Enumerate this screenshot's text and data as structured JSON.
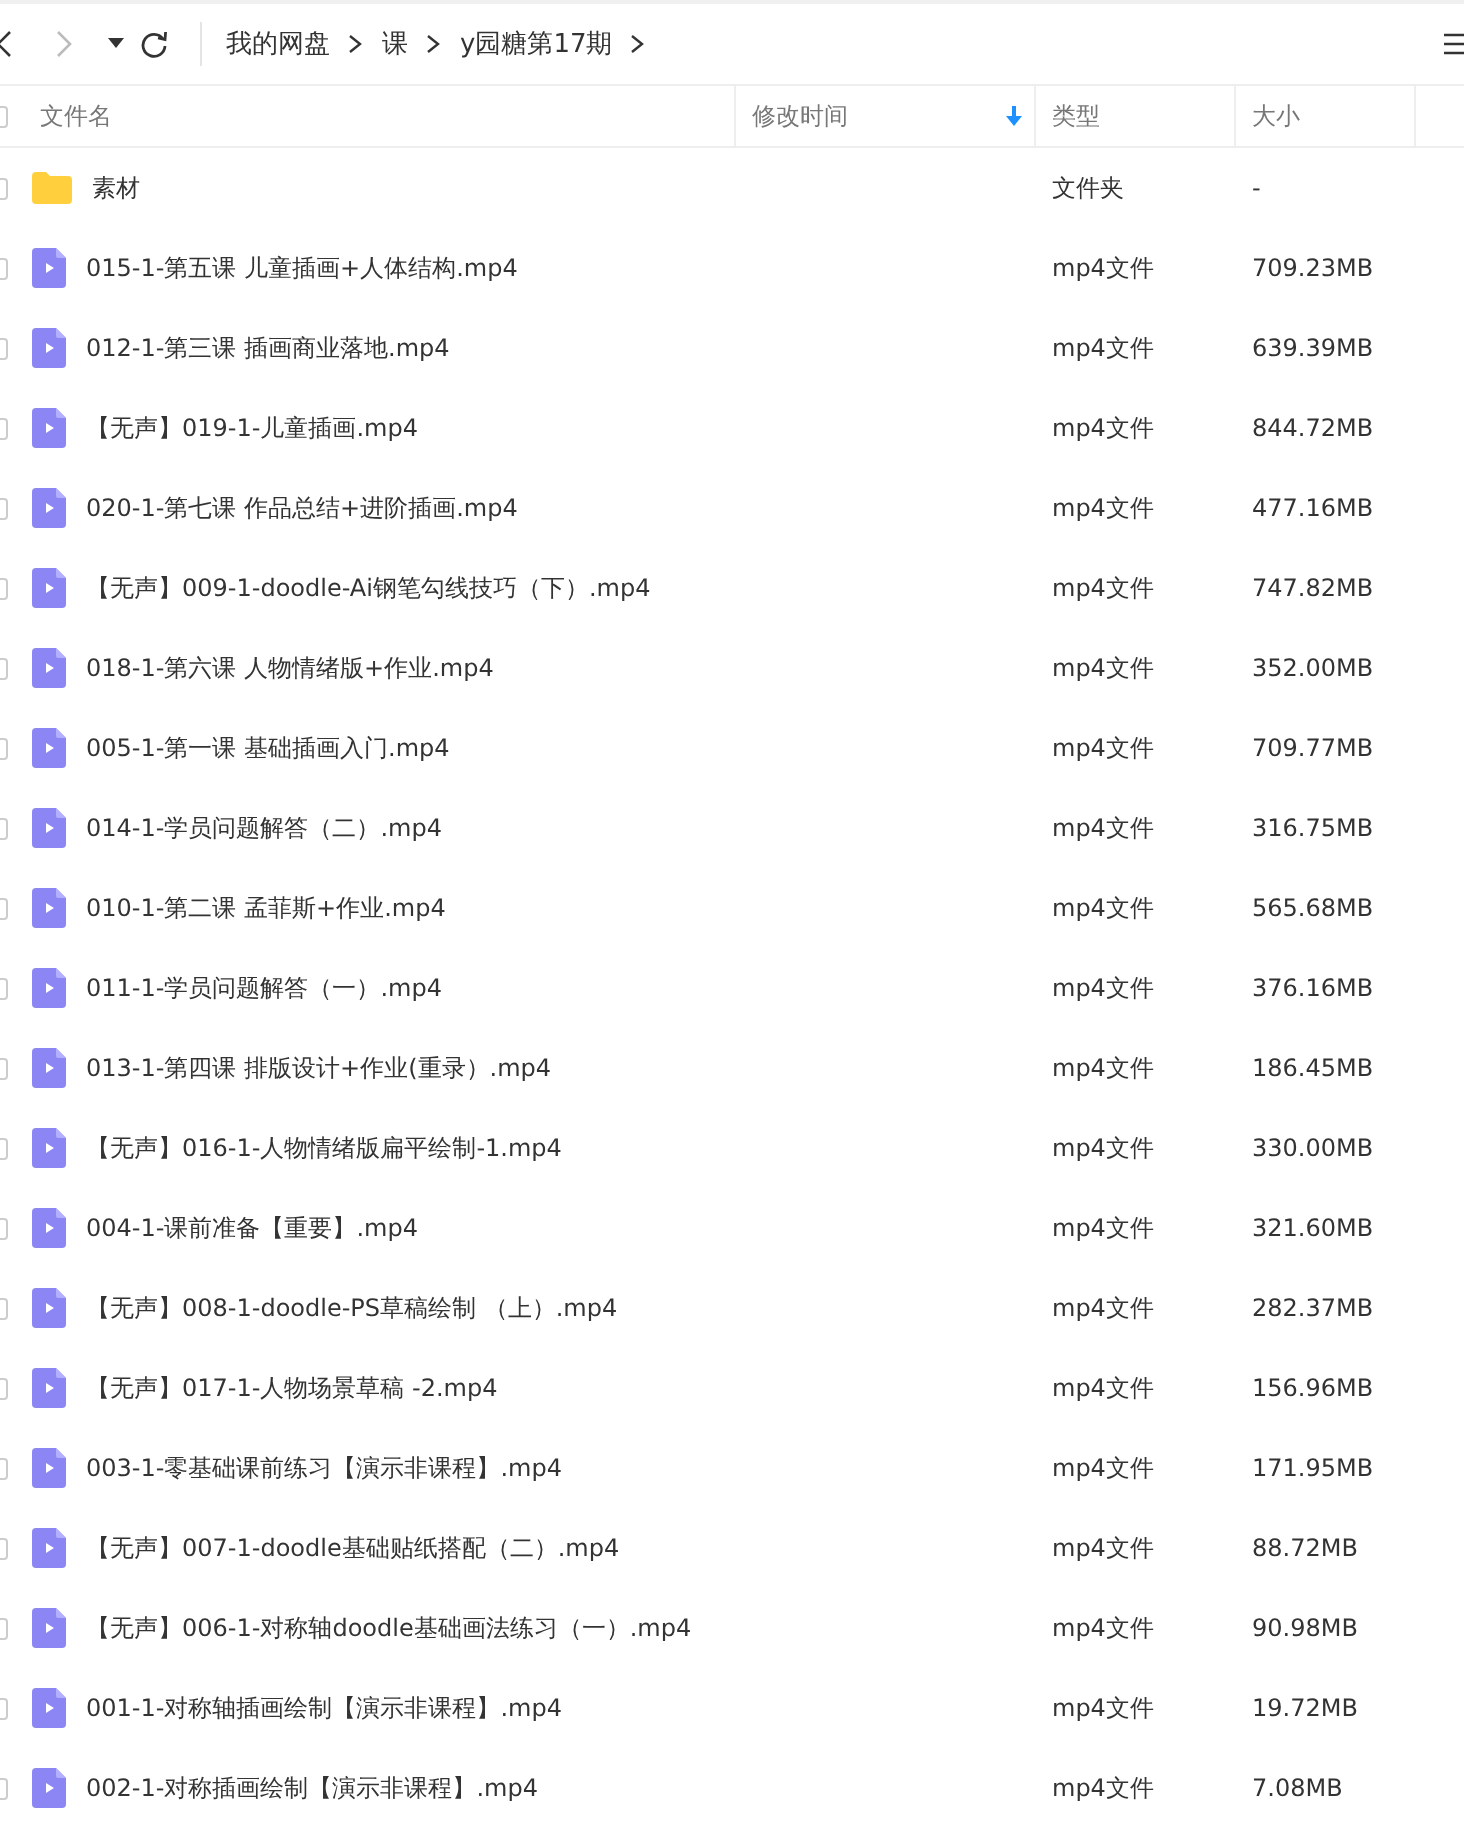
{
  "breadcrumb": [
    "我的网盘",
    "课",
    "y园糖第17期"
  ],
  "table": {
    "columns": [
      {
        "label": "文件名",
        "sorted": false
      },
      {
        "label": "修改时间",
        "sorted": true
      },
      {
        "label": "类型",
        "sorted": false
      },
      {
        "label": "大小",
        "sorted": false
      }
    ],
    "header_checked": false,
    "rows": [
      {
        "kind": "folder",
        "name": "素材",
        "type": "文件夹",
        "size": "-",
        "checked": false
      },
      {
        "kind": "video",
        "name": "015-1-第五课 儿童插画+人体结构.mp4",
        "type": "mp4文件",
        "size": "709.23MB",
        "checked": false
      },
      {
        "kind": "video",
        "name": "012-1-第三课 插画商业落地.mp4",
        "type": "mp4文件",
        "size": "639.39MB",
        "checked": false
      },
      {
        "kind": "video",
        "name": "【无声】019-1-儿童插画.mp4",
        "type": "mp4文件",
        "size": "844.72MB",
        "checked": false
      },
      {
        "kind": "video",
        "name": "020-1-第七课 作品总结+进阶插画.mp4",
        "type": "mp4文件",
        "size": "477.16MB",
        "checked": false
      },
      {
        "kind": "video",
        "name": "【无声】009-1-doodle-Ai钢笔勾线技巧（下）.mp4",
        "type": "mp4文件",
        "size": "747.82MB",
        "checked": false
      },
      {
        "kind": "video",
        "name": "018-1-第六课 人物情绪版+作业.mp4",
        "type": "mp4文件",
        "size": "352.00MB",
        "checked": false
      },
      {
        "kind": "video",
        "name": "005-1-第一课 基础插画入门.mp4",
        "type": "mp4文件",
        "size": "709.77MB",
        "checked": false
      },
      {
        "kind": "video",
        "name": "014-1-学员问题解答（二）.mp4",
        "type": "mp4文件",
        "size": "316.75MB",
        "checked": false
      },
      {
        "kind": "video",
        "name": "010-1-第二课 孟菲斯+作业.mp4",
        "type": "mp4文件",
        "size": "565.68MB",
        "checked": false
      },
      {
        "kind": "video",
        "name": "011-1-学员问题解答（一）.mp4",
        "type": "mp4文件",
        "size": "376.16MB",
        "checked": false
      },
      {
        "kind": "video",
        "name": "013-1-第四课 排版设计+作业(重录）.mp4",
        "type": "mp4文件",
        "size": "186.45MB",
        "checked": false
      },
      {
        "kind": "video",
        "name": "【无声】016-1-人物情绪版扁平绘制-1.mp4",
        "type": "mp4文件",
        "size": "330.00MB",
        "checked": false
      },
      {
        "kind": "video",
        "name": "004-1-课前准备【重要】.mp4",
        "type": "mp4文件",
        "size": "321.60MB",
        "checked": false
      },
      {
        "kind": "video",
        "name": "【无声】008-1-doodle-PS草稿绘制 （上）.mp4",
        "type": "mp4文件",
        "size": "282.37MB",
        "checked": false
      },
      {
        "kind": "video",
        "name": "【无声】017-1-人物场景草稿 -2.mp4",
        "type": "mp4文件",
        "size": "156.96MB",
        "checked": false
      },
      {
        "kind": "video",
        "name": "003-1-零基础课前练习【演示非课程】.mp4",
        "type": "mp4文件",
        "size": "171.95MB",
        "checked": false
      },
      {
        "kind": "video",
        "name": "【无声】007-1-doodle基础贴纸搭配（二）.mp4",
        "type": "mp4文件",
        "size": "88.72MB",
        "checked": false
      },
      {
        "kind": "video",
        "name": "【无声】006-1-对称轴doodle基础画法练习（一）.mp4",
        "type": "mp4文件",
        "size": "90.98MB",
        "checked": false
      },
      {
        "kind": "video",
        "name": "001-1-对称轴插画绘制【演示非课程】.mp4",
        "type": "mp4文件",
        "size": "19.72MB",
        "checked": false
      },
      {
        "kind": "video",
        "name": "002-1-对称插画绘制【演示非课程】.mp4",
        "type": "mp4文件",
        "size": "7.08MB",
        "checked": false
      }
    ]
  }
}
